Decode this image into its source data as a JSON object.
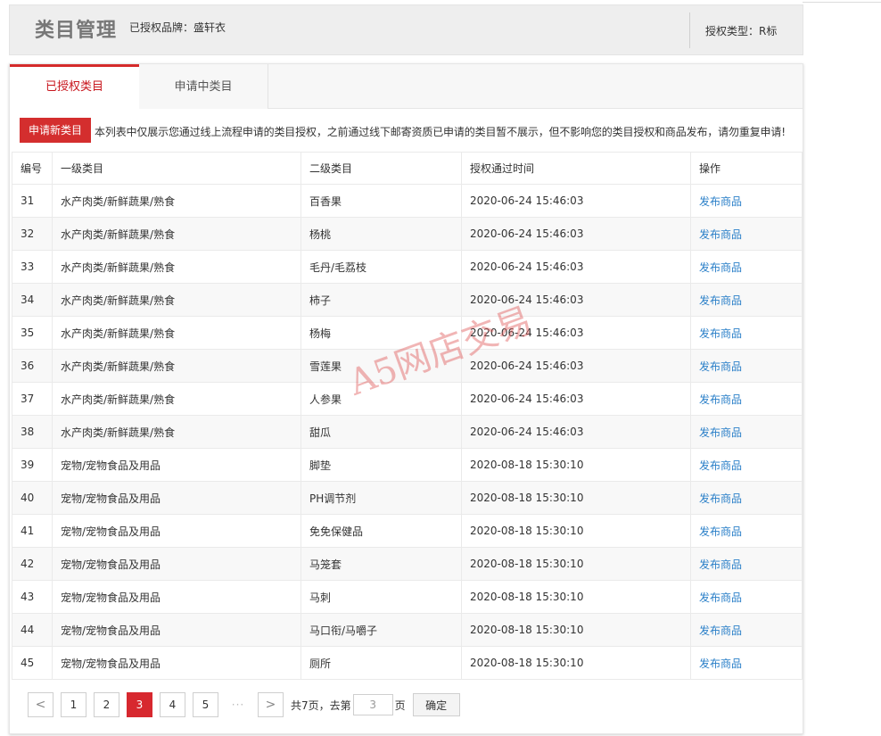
{
  "header": {
    "title": "类目管理",
    "brand": "已授权品牌：盛轩衣",
    "auth_type": "授权类型：R标"
  },
  "tabs": [
    {
      "label": "已授权类目"
    },
    {
      "label": "申请中类目"
    }
  ],
  "notice": {
    "button_label": "申请新类目",
    "text": "本列表中仅展示您通过线上流程申请的类目授权，之前通过线下邮寄资质已申请的类目暂不展示，但不影响您的类目授权和商品发布，请勿重复申请!"
  },
  "table": {
    "headers": [
      "编号",
      "一级类目",
      "二级类目",
      "授权通过时间",
      "操作"
    ],
    "rows": [
      {
        "id": "31",
        "level1": "水产肉类/新鲜蔬果/熟食",
        "level2": "百香果",
        "time": "2020-06-24 15:46:03",
        "action": "发布商品"
      },
      {
        "id": "32",
        "level1": "水产肉类/新鲜蔬果/熟食",
        "level2": "杨桃",
        "time": "2020-06-24 15:46:03",
        "action": "发布商品"
      },
      {
        "id": "33",
        "level1": "水产肉类/新鲜蔬果/熟食",
        "level2": "毛丹/毛荔枝",
        "time": "2020-06-24 15:46:03",
        "action": "发布商品"
      },
      {
        "id": "34",
        "level1": "水产肉类/新鲜蔬果/熟食",
        "level2": "柿子",
        "time": "2020-06-24 15:46:03",
        "action": "发布商品"
      },
      {
        "id": "35",
        "level1": "水产肉类/新鲜蔬果/熟食",
        "level2": "杨梅",
        "time": "2020-06-24 15:46:03",
        "action": "发布商品"
      },
      {
        "id": "36",
        "level1": "水产肉类/新鲜蔬果/熟食",
        "level2": "雪莲果",
        "time": "2020-06-24 15:46:03",
        "action": "发布商品"
      },
      {
        "id": "37",
        "level1": "水产肉类/新鲜蔬果/熟食",
        "level2": "人参果",
        "time": "2020-06-24 15:46:03",
        "action": "发布商品"
      },
      {
        "id": "38",
        "level1": "水产肉类/新鲜蔬果/熟食",
        "level2": "甜瓜",
        "time": "2020-06-24 15:46:03",
        "action": "发布商品"
      },
      {
        "id": "39",
        "level1": "宠物/宠物食品及用品",
        "level2": "脚垫",
        "time": "2020-08-18 15:30:10",
        "action": "发布商品"
      },
      {
        "id": "40",
        "level1": "宠物/宠物食品及用品",
        "level2": "PH调节剂",
        "time": "2020-08-18 15:30:10",
        "action": "发布商品"
      },
      {
        "id": "41",
        "level1": "宠物/宠物食品及用品",
        "level2": "免免保健品",
        "time": "2020-08-18 15:30:10",
        "action": "发布商品"
      },
      {
        "id": "42",
        "level1": "宠物/宠物食品及用品",
        "level2": "马笼套",
        "time": "2020-08-18 15:30:10",
        "action": "发布商品"
      },
      {
        "id": "43",
        "level1": "宠物/宠物食品及用品",
        "level2": "马刺",
        "time": "2020-08-18 15:30:10",
        "action": "发布商品"
      },
      {
        "id": "44",
        "level1": "宠物/宠物食品及用品",
        "level2": "马口衔/马嚼子",
        "time": "2020-08-18 15:30:10",
        "action": "发布商品"
      },
      {
        "id": "45",
        "level1": "宠物/宠物食品及用品",
        "level2": "厕所",
        "time": "2020-08-18 15:30:10",
        "action": "发布商品"
      }
    ]
  },
  "pagination": {
    "prev_icon": "<",
    "next_icon": ">",
    "pages": [
      "1",
      "2",
      "3",
      "4",
      "5"
    ],
    "current": "3",
    "ellipsis": "···",
    "total_text": "共7页，去第",
    "input_value": "3",
    "page_suffix": "页",
    "confirm_label": "确定"
  },
  "watermark": "A5网店交易",
  "colors": {
    "accent": "#d42e2e",
    "link": "#2a7fc8",
    "header_bg": "#eeeeee"
  }
}
